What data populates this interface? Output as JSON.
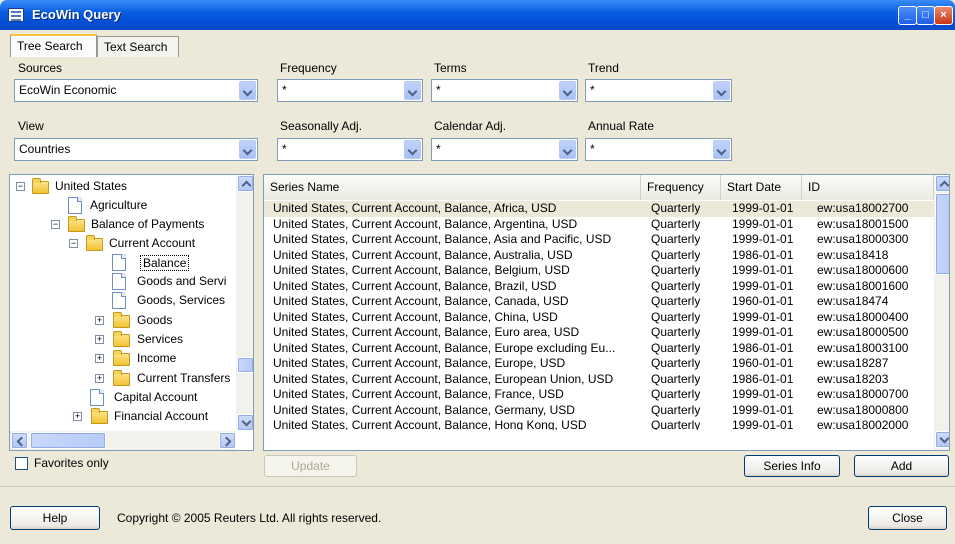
{
  "window": {
    "title": "EcoWin Query",
    "buttons": [
      "minimize-icon",
      "maximize-icon",
      "close-icon"
    ]
  },
  "tabs": [
    {
      "label": "Tree Search",
      "active": true
    },
    {
      "label": "Text Search",
      "active": false
    }
  ],
  "filters": {
    "sources": {
      "label": "Sources",
      "value": "EcoWin Economic"
    },
    "view": {
      "label": "View",
      "value": "Countries"
    },
    "frequency": {
      "label": "Frequency",
      "value": "*"
    },
    "terms": {
      "label": "Terms",
      "value": "*"
    },
    "trend": {
      "label": "Trend",
      "value": "*"
    },
    "seasonally_adj": {
      "label": "Seasonally Adj.",
      "value": "*"
    },
    "calendar_adj": {
      "label": "Calendar Adj.",
      "value": "*"
    },
    "annual_rate": {
      "label": "Annual Rate",
      "value": "*"
    }
  },
  "tree": {
    "items": [
      {
        "label": "United States",
        "kind": "folder",
        "expander": "−"
      },
      {
        "label": "Agriculture",
        "kind": "doc"
      },
      {
        "label": "Balance of Payments",
        "kind": "folder",
        "expander": "−"
      },
      {
        "label": "Current Account",
        "kind": "folder",
        "expander": "−"
      },
      {
        "label": "Balance",
        "kind": "doc",
        "selected": true
      },
      {
        "label": "Goods and Servi",
        "kind": "doc"
      },
      {
        "label": "Goods, Services",
        "kind": "doc"
      },
      {
        "label": "Goods",
        "kind": "folder",
        "expander": "+"
      },
      {
        "label": "Services",
        "kind": "folder",
        "expander": "+"
      },
      {
        "label": "Income",
        "kind": "folder",
        "expander": "+"
      },
      {
        "label": "Current Transfers",
        "kind": "folder",
        "expander": "+"
      },
      {
        "label": "Capital Account",
        "kind": "doc"
      },
      {
        "label": "Financial Account",
        "kind": "folder",
        "expander": "+"
      }
    ]
  },
  "favorites": {
    "label": "Favorites only",
    "checked": false
  },
  "grid": {
    "columns": [
      "Series Name",
      "Frequency",
      "Start Date",
      "ID"
    ],
    "rows": [
      [
        "United States, Current Account, Balance, Africa, USD",
        "Quarterly",
        "1999-01-01",
        "ew:usa18002700"
      ],
      [
        "United States, Current Account, Balance, Argentina, USD",
        "Quarterly",
        "1999-01-01",
        "ew:usa18001500"
      ],
      [
        "United States, Current Account, Balance, Asia and Pacific, USD",
        "Quarterly",
        "1999-01-01",
        "ew:usa18000300"
      ],
      [
        "United States, Current Account, Balance, Australia, USD",
        "Quarterly",
        "1986-01-01",
        "ew:usa18418"
      ],
      [
        "United States, Current Account, Balance, Belgium, USD",
        "Quarterly",
        "1999-01-01",
        "ew:usa18000600"
      ],
      [
        "United States, Current Account, Balance, Brazil, USD",
        "Quarterly",
        "1999-01-01",
        "ew:usa18001600"
      ],
      [
        "United States, Current Account, Balance, Canada, USD",
        "Quarterly",
        "1960-01-01",
        "ew:usa18474"
      ],
      [
        "United States, Current Account, Balance, China, USD",
        "Quarterly",
        "1999-01-01",
        "ew:usa18000400"
      ],
      [
        "United States, Current Account, Balance, Euro area, USD",
        "Quarterly",
        "1999-01-01",
        "ew:usa18000500"
      ],
      [
        "United States, Current Account, Balance, Europe excluding Eu...",
        "Quarterly",
        "1986-01-01",
        "ew:usa18003100"
      ],
      [
        "United States, Current Account, Balance, Europe, USD",
        "Quarterly",
        "1960-01-01",
        "ew:usa18287"
      ],
      [
        "United States, Current Account, Balance, European Union, USD",
        "Quarterly",
        "1986-01-01",
        "ew:usa18203"
      ],
      [
        "United States, Current Account, Balance, France, USD",
        "Quarterly",
        "1999-01-01",
        "ew:usa18000700"
      ],
      [
        "United States, Current Account, Balance, Germany, USD",
        "Quarterly",
        "1999-01-01",
        "ew:usa18000800"
      ],
      [
        "United States, Current Account, Balance, Hong Kong, USD",
        "Quarterly",
        "1999-01-01",
        "ew:usa18002000"
      ]
    ]
  },
  "actions": {
    "update": "Update",
    "series_info": "Series Info",
    "add": "Add",
    "help": "Help",
    "close": "Close"
  },
  "footer": {
    "copyright": "Copyright © 2005 Reuters Ltd.  All rights reserved."
  }
}
